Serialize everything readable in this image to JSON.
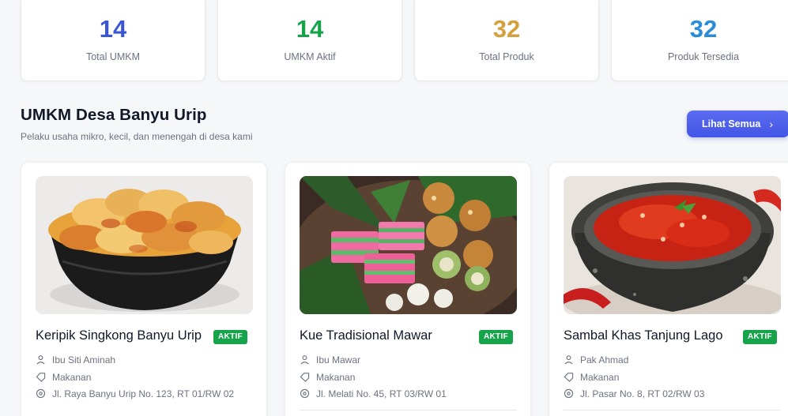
{
  "stats": [
    {
      "value": "14",
      "label": "Total UMKM",
      "color": "#3b55d8"
    },
    {
      "value": "14",
      "label": "UMKM Aktif",
      "color": "#16a34a"
    },
    {
      "value": "32",
      "label": "Total Produk",
      "color": "#d4a03e"
    },
    {
      "value": "32",
      "label": "Produk Tersedia",
      "color": "#2a8bd6"
    }
  ],
  "section": {
    "title": "UMKM Desa Banyu Urip",
    "subtitle": "Pelaku usaha mikro, kecil, dan menengah di desa kami",
    "see_all_label": "Lihat Semua",
    "see_all_icon": "chevron-right-icon"
  },
  "umkm": [
    {
      "name": "Keripik Singkong Banyu Urip",
      "status": "AKTIF",
      "owner": "Ibu Siti Aminah",
      "category": "Makanan",
      "address": "Jl. Raya Banyu Urip No. 123, RT 01/RW 02",
      "image": "cassava-chips-photo"
    },
    {
      "name": "Kue Tradisional Mawar",
      "status": "AKTIF",
      "owner": "Ibu Mawar",
      "category": "Makanan",
      "address": "Jl. Melati No. 45, RT 03/RW 01",
      "image": "traditional-cakes-photo"
    },
    {
      "name": "Sambal Khas Tanjung Lago",
      "status": "AKTIF",
      "owner": "Pak Ahmad",
      "category": "Makanan",
      "address": "Jl. Pasar No. 8, RT 02/RW 03",
      "image": "sambal-photo"
    }
  ],
  "icons": {
    "owner": "user-icon",
    "category": "tag-icon",
    "address": "location-pin-icon"
  },
  "colors": {
    "accent": "#4a5ce9",
    "active_badge": "#16a34a"
  }
}
